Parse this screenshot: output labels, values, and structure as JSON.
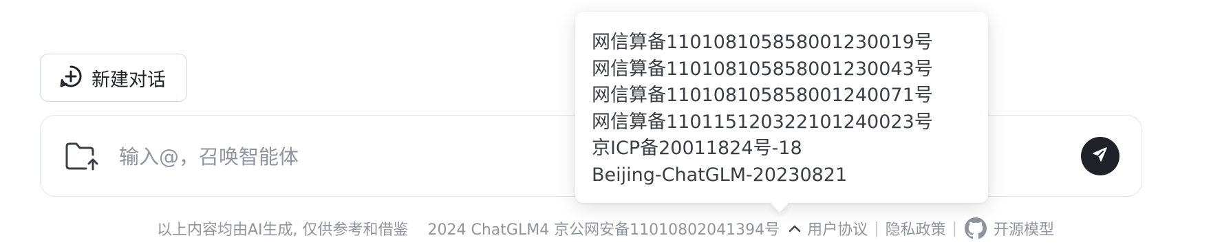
{
  "new_chat": {
    "label": "新建对话",
    "icon": "chat-plus-icon"
  },
  "composer": {
    "placeholder": "输入@，召唤智能体",
    "value": "",
    "attach_icon": "folder-upload-icon",
    "send_icon": "send-icon"
  },
  "footer": {
    "disclaimer": "以上内容均由AI生成, 仅供参考和借鉴",
    "copyright": "2024 ChatGLM4 京公网安备11010802041394号",
    "toggle_icon": "chevron-up-icon",
    "user_agreement": "用户协议",
    "separator": "|",
    "privacy_policy": "隐私政策",
    "github_icon": "github-icon",
    "open_source": "开源模型"
  },
  "registrations": {
    "items": [
      "网信算备110108105858001230019号",
      "网信算备110108105858001230043号",
      "网信算备110108105858001240071号",
      "网信算备110115120322101240023号",
      "京ICP备20011824号-18",
      "Beijing-ChatGLM-20230821"
    ]
  },
  "colors": {
    "text": "#1f2329",
    "muted": "#8f959e",
    "border": "#dfe3eb",
    "send_bg": "#1f2329"
  }
}
